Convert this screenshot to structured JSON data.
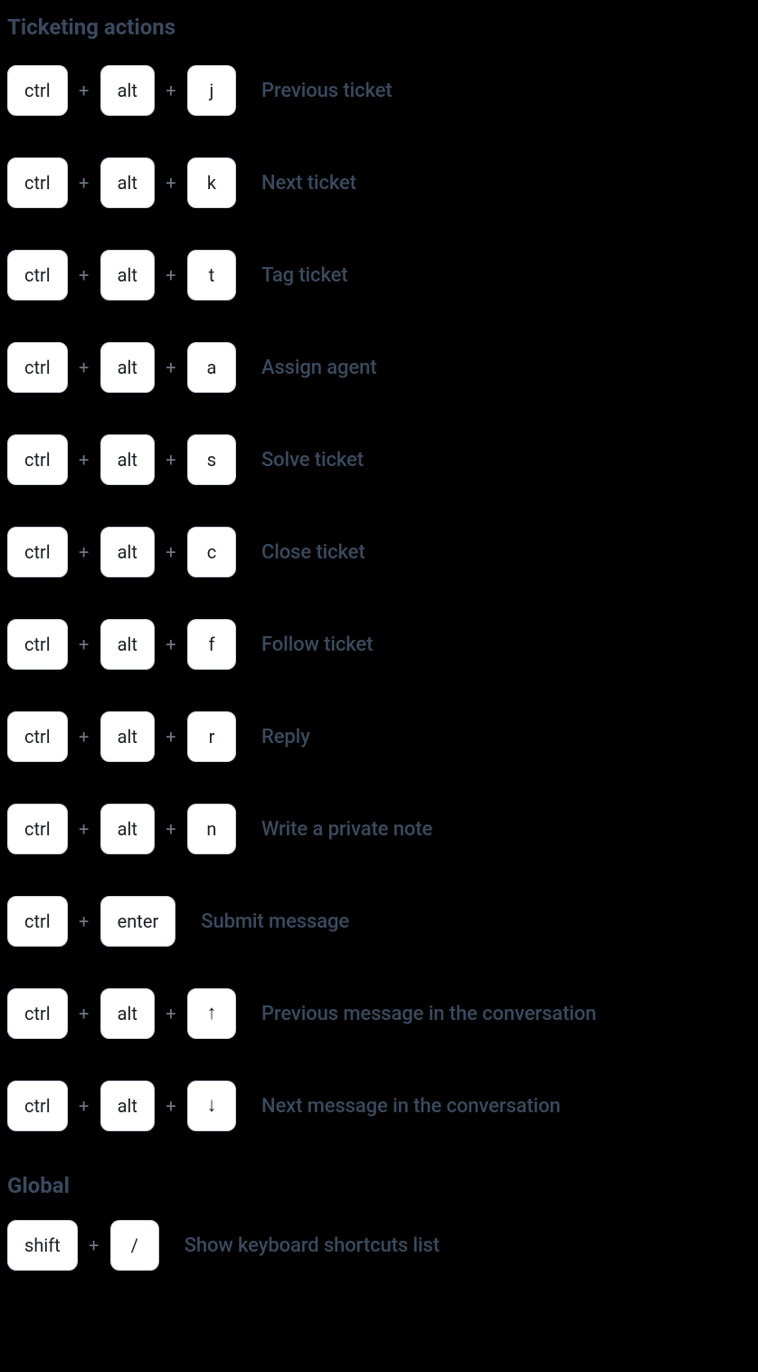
{
  "sections": [
    {
      "title": "Ticketing actions",
      "shortcuts": [
        {
          "keys": [
            "ctrl",
            "alt",
            "j"
          ],
          "desc": "Previous ticket"
        },
        {
          "keys": [
            "ctrl",
            "alt",
            "k"
          ],
          "desc": "Next ticket"
        },
        {
          "keys": [
            "ctrl",
            "alt",
            "t"
          ],
          "desc": "Tag ticket"
        },
        {
          "keys": [
            "ctrl",
            "alt",
            "a"
          ],
          "desc": "Assign agent"
        },
        {
          "keys": [
            "ctrl",
            "alt",
            "s"
          ],
          "desc": "Solve ticket"
        },
        {
          "keys": [
            "ctrl",
            "alt",
            "c"
          ],
          "desc": "Close ticket"
        },
        {
          "keys": [
            "ctrl",
            "alt",
            "f"
          ],
          "desc": "Follow ticket"
        },
        {
          "keys": [
            "ctrl",
            "alt",
            "r"
          ],
          "desc": "Reply"
        },
        {
          "keys": [
            "ctrl",
            "alt",
            "n"
          ],
          "desc": "Write a private note"
        },
        {
          "keys": [
            "ctrl",
            "enter"
          ],
          "desc": "Submit message"
        },
        {
          "keys": [
            "ctrl",
            "alt",
            "↑"
          ],
          "desc": "Previous message in the conversation"
        },
        {
          "keys": [
            "ctrl",
            "alt",
            "↓"
          ],
          "desc": "Next message in the conversation"
        }
      ]
    },
    {
      "title": "Global",
      "shortcuts": [
        {
          "keys": [
            "shift",
            "/"
          ],
          "desc": "Show keyboard shortcuts list"
        }
      ]
    }
  ],
  "plus": "+"
}
